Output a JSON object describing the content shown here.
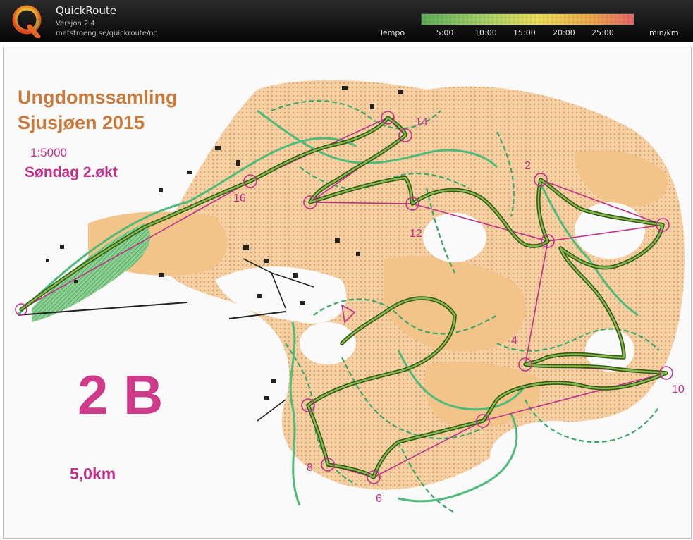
{
  "app": {
    "title": "QuickRoute",
    "version": "Versjon 2.4",
    "url": "matstroeng.se/quickroute/no",
    "logo_letter": "Q"
  },
  "tempo_legend": {
    "label": "Tempo",
    "unit": "min/km",
    "ticks": [
      "5:00",
      "10:00",
      "15:00",
      "20:00",
      "25:00"
    ],
    "gradient": [
      "#5fb05a",
      "#a9d36a",
      "#efe15a",
      "#f0a84e",
      "#e8676a"
    ]
  },
  "map": {
    "title_line1": "Ungdomssamling",
    "title_line2": "Sjusjøen 2015",
    "scale": "1:5000",
    "session": "Søndag 2.økt",
    "course": "2 B",
    "distance": "5,0km",
    "controls": [
      "14",
      "2",
      "16",
      "12",
      "4",
      "10",
      "8",
      "6"
    ],
    "colors": {
      "title": "#c97a3a",
      "magenta": "#c0308a",
      "open_land": "#f2c48a",
      "route_green": "#4a8a2a",
      "path_green": "#3aa86a"
    }
  }
}
